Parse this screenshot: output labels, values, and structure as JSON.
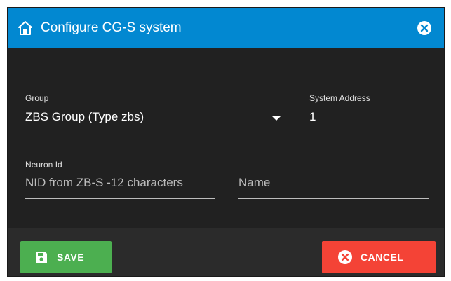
{
  "dialog": {
    "title": "Configure CG-S system",
    "header_icon": "home-icon",
    "close_icon": "close-icon",
    "colors": {
      "header": "#0288d1",
      "body": "#212121",
      "save": "#4caf50",
      "cancel": "#f44336"
    }
  },
  "form": {
    "group": {
      "label": "Group",
      "value": "ZBS Group (Type zbs)"
    },
    "system_address": {
      "label": "System Address",
      "value": "1"
    },
    "neuron_id": {
      "label": "Neuron Id",
      "placeholder": "NID from ZB-S -12 characters"
    },
    "name": {
      "placeholder": "Name"
    }
  },
  "buttons": {
    "save": {
      "label": "SAVE",
      "icon": "floppy-disk-icon"
    },
    "cancel": {
      "label": "CANCEL",
      "icon": "cancel-circle-icon"
    }
  }
}
